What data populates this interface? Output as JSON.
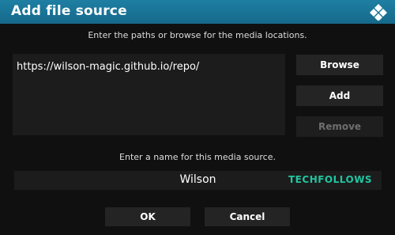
{
  "dialog": {
    "title": "Add file source"
  },
  "paths": {
    "instruction": "Enter the paths or browse for the media locations.",
    "value": "https://wilson-magic.github.io/repo/"
  },
  "buttons": {
    "browse": "Browse",
    "add": "Add",
    "remove": "Remove",
    "ok": "OK",
    "cancel": "Cancel"
  },
  "name": {
    "instruction": "Enter a name for this media source.",
    "value": "Wilson"
  },
  "watermark": "TECHFOLLOWS",
  "colors": {
    "title_bar": "#1e7fa3",
    "watermark": "#21c6a0",
    "disabled_text": "#6e6e6e"
  },
  "icons": {
    "logo": "kodi-logo-icon"
  }
}
